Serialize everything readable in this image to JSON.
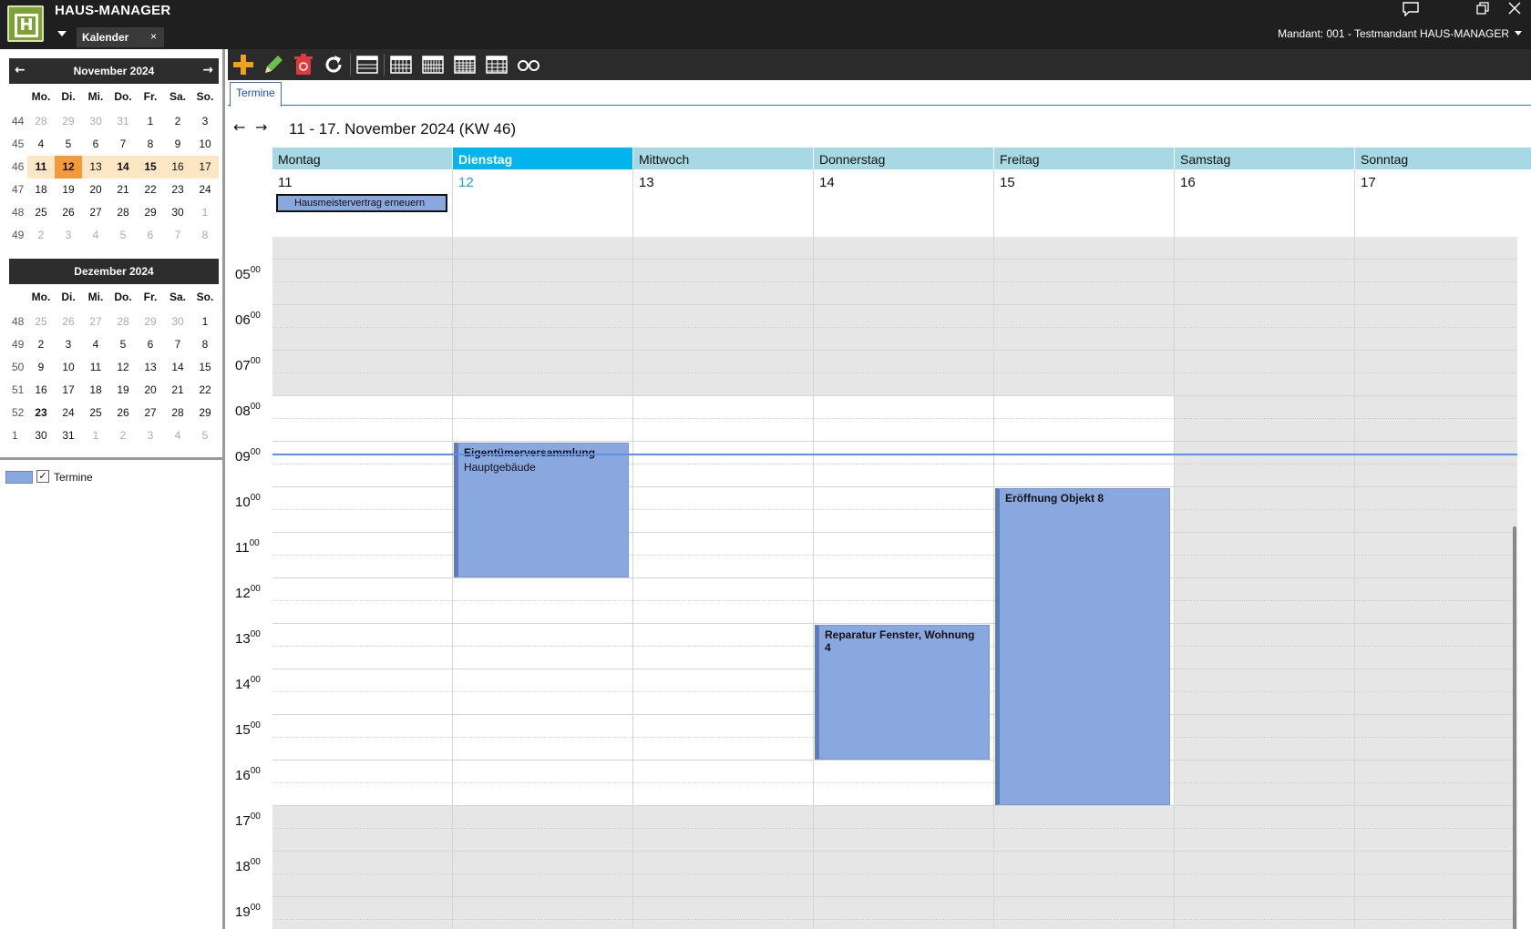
{
  "titlebar": {
    "app_title": "HAUS-MANAGER",
    "doc_tab": "Kalender",
    "doc_tab_close": "×",
    "mandant": "Mandant: 001 - Testmandant HAUS-MANAGER",
    "icons": [
      "chat-icon",
      "restore-icon",
      "close-icon"
    ]
  },
  "minical": {
    "dow": [
      "Mo.",
      "Di.",
      "Mi.",
      "Do.",
      "Fr.",
      "Sa.",
      "So."
    ],
    "nov": {
      "title": "November 2024",
      "weeks": [
        {
          "wk": "44",
          "days": [
            "28",
            "29",
            "30",
            "31",
            "1",
            "2",
            "3"
          ]
        },
        {
          "wk": "45",
          "days": [
            "4",
            "5",
            "6",
            "7",
            "8",
            "9",
            "10"
          ]
        },
        {
          "wk": "46",
          "days": [
            "11",
            "12",
            "13",
            "14",
            "15",
            "16",
            "17"
          ]
        },
        {
          "wk": "47",
          "days": [
            "18",
            "19",
            "20",
            "21",
            "22",
            "23",
            "24"
          ]
        },
        {
          "wk": "48",
          "days": [
            "25",
            "26",
            "27",
            "28",
            "29",
            "30",
            "1"
          ]
        },
        {
          "wk": "49",
          "days": [
            "2",
            "3",
            "4",
            "5",
            "6",
            "7",
            "8"
          ]
        }
      ]
    },
    "dec": {
      "title": "Dezember 2024",
      "weeks": [
        {
          "wk": "48",
          "days": [
            "25",
            "26",
            "27",
            "28",
            "29",
            "30",
            "1"
          ]
        },
        {
          "wk": "49",
          "days": [
            "2",
            "3",
            "4",
            "5",
            "6",
            "7",
            "8"
          ]
        },
        {
          "wk": "50",
          "days": [
            "9",
            "10",
            "11",
            "12",
            "13",
            "14",
            "15"
          ]
        },
        {
          "wk": "51",
          "days": [
            "16",
            "17",
            "18",
            "19",
            "20",
            "21",
            "22"
          ]
        },
        {
          "wk": "52",
          "days": [
            "23",
            "24",
            "25",
            "26",
            "27",
            "28",
            "29"
          ]
        },
        {
          "wk": "1",
          "days": [
            "30",
            "31",
            "1",
            "2",
            "3",
            "4",
            "5"
          ]
        }
      ]
    }
  },
  "legend": {
    "label": "Termine",
    "checked": "✓",
    "color": "#8aa8e0"
  },
  "toolbar": {
    "buttons": [
      "add-icon",
      "edit-icon",
      "delete-icon",
      "refresh-icon",
      "day-view-icon",
      "workweek-view-icon",
      "week-view-icon",
      "month-view-icon",
      "timeline-view-icon",
      "search-glasses-icon"
    ]
  },
  "tabstrip": {
    "tab": "Termine"
  },
  "nav": {
    "prev": "←",
    "next": "→",
    "range": "11 - 17. November 2024 (KW 46)"
  },
  "week": {
    "days": [
      {
        "name": "Montag",
        "num": "11"
      },
      {
        "name": "Dienstag",
        "num": "12"
      },
      {
        "name": "Mittwoch",
        "num": "13"
      },
      {
        "name": "Donnerstag",
        "num": "14"
      },
      {
        "name": "Freitag",
        "num": "15"
      },
      {
        "name": "Samstag",
        "num": "16"
      },
      {
        "name": "Sonntag",
        "num": "17"
      }
    ],
    "allday_event": "Hausmeistervertrag erneuern",
    "hours": [
      "05",
      "06",
      "07",
      "08",
      "09",
      "10",
      "11",
      "12",
      "13",
      "14",
      "15",
      "16",
      "17",
      "18",
      "19"
    ],
    "minutes": "00",
    "events": [
      {
        "title": "Eigentümerversammlung",
        "subtitle": "Hauptgebäude",
        "day": "Dienstag",
        "start": "09:00",
        "end": "12:00"
      },
      {
        "title": "Reparatur Fenster, Wohnung 4",
        "subtitle": "",
        "day": "Donnerstag",
        "start": "13:00",
        "end": "16:00"
      },
      {
        "title": "Eröffnung Objekt 8",
        "subtitle": "",
        "day": "Freitag",
        "start": "10:00",
        "end": "17:00"
      }
    ],
    "current_time": "09:15"
  }
}
